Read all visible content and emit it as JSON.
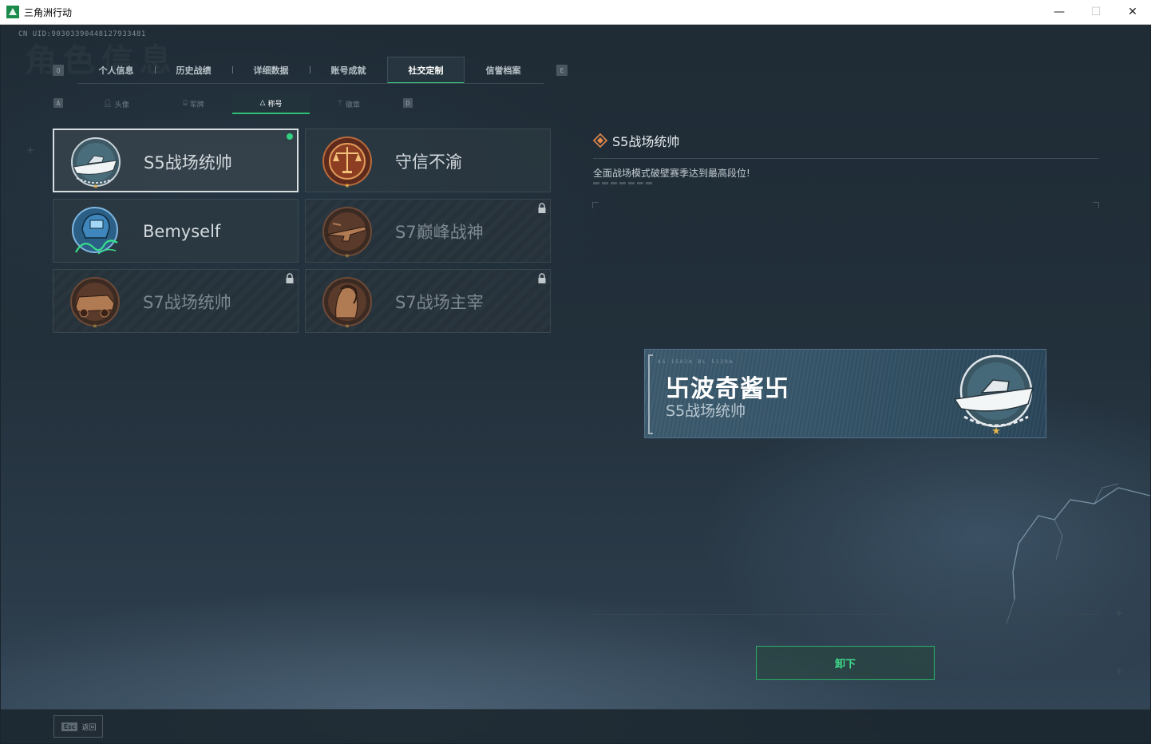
{
  "window": {
    "title": "三角洲行动",
    "minimize": "—",
    "maximize": "☐",
    "close": "✕"
  },
  "header": {
    "uid": "CN UID:9030339044812793348​1",
    "bg_title": "角色信息"
  },
  "tabs": {
    "left_key": "Q",
    "right_key": "E",
    "items": [
      {
        "label": "个人信息"
      },
      {
        "label": "历史战绩"
      },
      {
        "label": "详细数据"
      },
      {
        "label": "账号成就"
      },
      {
        "label": "社交定制",
        "active": true
      },
      {
        "label": "信誉档案"
      }
    ]
  },
  "subtabs": {
    "left_key": "A",
    "right_key": "D",
    "items": [
      {
        "label": "头像",
        "icon": "user-icon"
      },
      {
        "label": "军牌",
        "icon": "dogtag-icon"
      },
      {
        "label": "称号",
        "icon": "title-icon",
        "active": true
      },
      {
        "label": "徽章",
        "icon": "emblem-icon"
      }
    ]
  },
  "titles": [
    {
      "label": "S5战场统帅",
      "badge": "speedboat-badge",
      "selected": true,
      "equipped": true,
      "locked": false
    },
    {
      "label": "守信不渝",
      "badge": "scales-badge",
      "selected": false,
      "equipped": false,
      "locked": false
    },
    {
      "label": "Bemyself",
      "badge": "helmet-signature-badge",
      "selected": false,
      "equipped": false,
      "locked": false
    },
    {
      "label": "S7巅峰战神",
      "badge": "rifle-badge",
      "selected": false,
      "equipped": false,
      "locked": true
    },
    {
      "label": "S7战场统帅",
      "badge": "armored-vehicle-badge",
      "selected": false,
      "equipped": false,
      "locked": true
    },
    {
      "label": "S7战场主宰",
      "badge": "warrior-portrait-badge",
      "selected": false,
      "equipped": false,
      "locked": true
    }
  ],
  "detail": {
    "title": "S5战场统帅",
    "description": "全面战场模式破壁赛季达到最高段位!",
    "nameplate": {
      "player_name": "卐波奇酱卐",
      "title": "S5战场统帅",
      "code": "AS 1502A  BL 5129A"
    },
    "unequip_label": "卸下"
  },
  "footer": {
    "esc_key": "Esc",
    "esc_label": "返回"
  },
  "colors": {
    "accent": "#36c77a",
    "panel": "#26353f",
    "text": "#d4dadd"
  }
}
